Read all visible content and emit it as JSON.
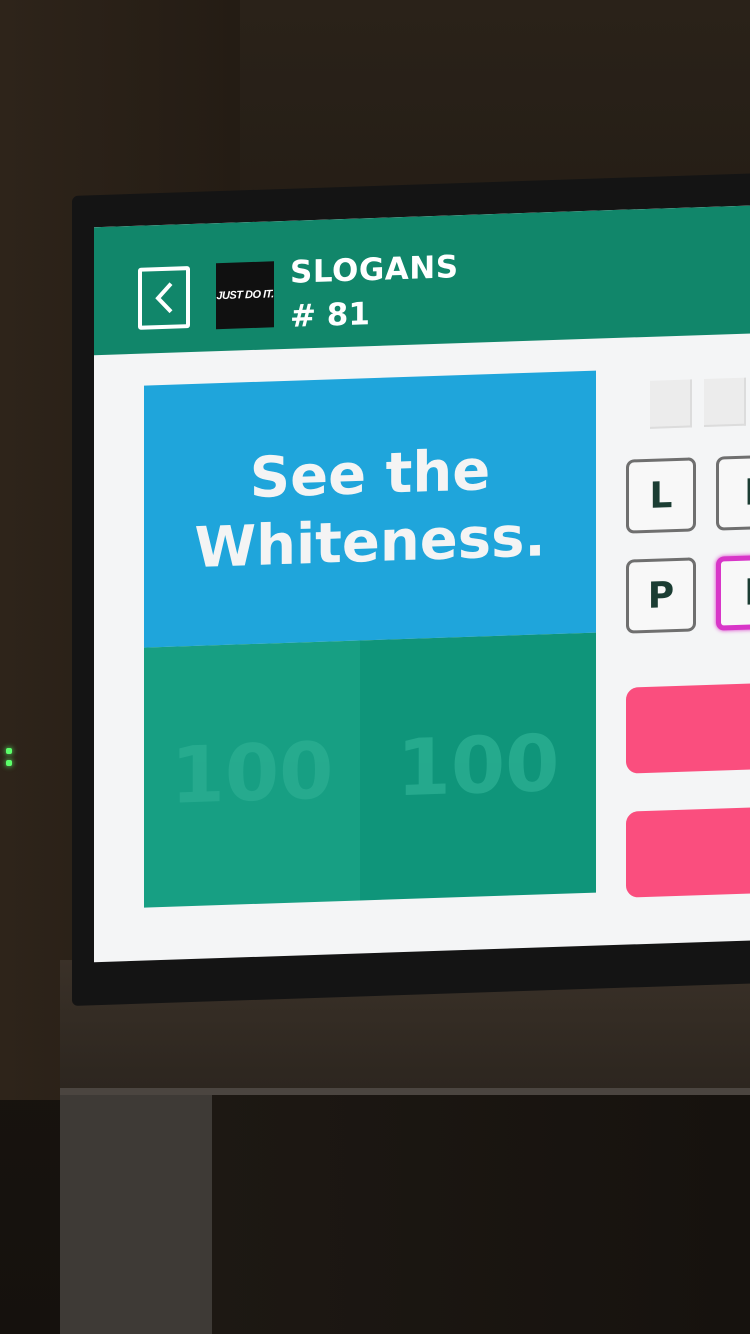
{
  "header": {
    "back_icon": "chevron-left-icon",
    "logo_text": "JUST DO IT.",
    "category": "SLOGANS",
    "level": "# 81"
  },
  "clue": {
    "line1": "See the",
    "line2": "Whiteness."
  },
  "tiles": [
    {
      "label": "100"
    },
    {
      "label": "100"
    }
  ],
  "keys": [
    {
      "label": "L"
    },
    {
      "label": "I"
    },
    {
      "label": "P"
    },
    {
      "label": "I"
    }
  ],
  "colors": {
    "header": "#11866a",
    "clue": "#1fa5db",
    "tile": "#149c7f",
    "action": "#fa4e7e",
    "highlight": "#d836c8"
  }
}
